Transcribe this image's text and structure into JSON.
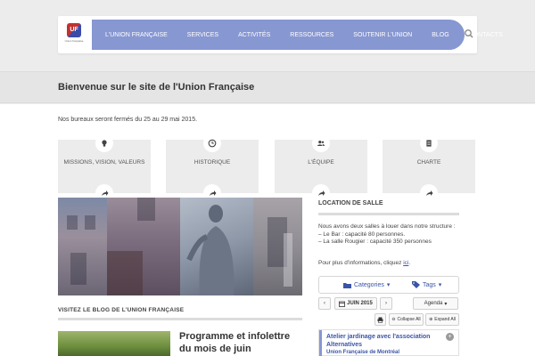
{
  "header": {
    "logo_text": "UF",
    "logo_subtext": "Union française",
    "nav": [
      "L'Union Française",
      "Services",
      "Activités",
      "Ressources",
      "Soutenir l'Union",
      "Blog",
      "Contacts"
    ],
    "search_icon": "search-icon"
  },
  "welcome": {
    "title": "Bienvenue sur le site de l'Union Française"
  },
  "notice": "Nos bureaux seront fermés du 25 au 29 mai 2015.",
  "cards": [
    {
      "label": "Missions, vision, valeurs",
      "icon": "lightbulb-icon"
    },
    {
      "label": "Historique",
      "icon": "clock-icon"
    },
    {
      "label": "L'équipe",
      "icon": "users-icon"
    },
    {
      "label": "Charte",
      "icon": "document-icon"
    }
  ],
  "blog": {
    "title": "Visitez le blog de l'Union Française",
    "post_title": "Programme et infolettre du mois de juin"
  },
  "sidebar": {
    "title": "Location de salle",
    "intro": "Nous avons deux salles à louer dans notre structure :",
    "line1": "– Le Bar : capacité 80 personnes.",
    "line2": "– La salle Rougier : capacité 350 personnes",
    "more_prefix": "Pour plus d'informations, cliquez ",
    "more_link": "ici",
    "more_suffix": "."
  },
  "calendar": {
    "categories": "Categories",
    "tags": "Tags",
    "month": "JUIN 2015",
    "view": "Agenda",
    "collapse": "Collapse All",
    "expand": "Expand All",
    "event_title": "Atelier jardinage avec l'association Alternatives",
    "event_org": "Union Française de Montréal"
  },
  "colors": {
    "nav": "#8797d2",
    "link": "#3a55a6"
  }
}
